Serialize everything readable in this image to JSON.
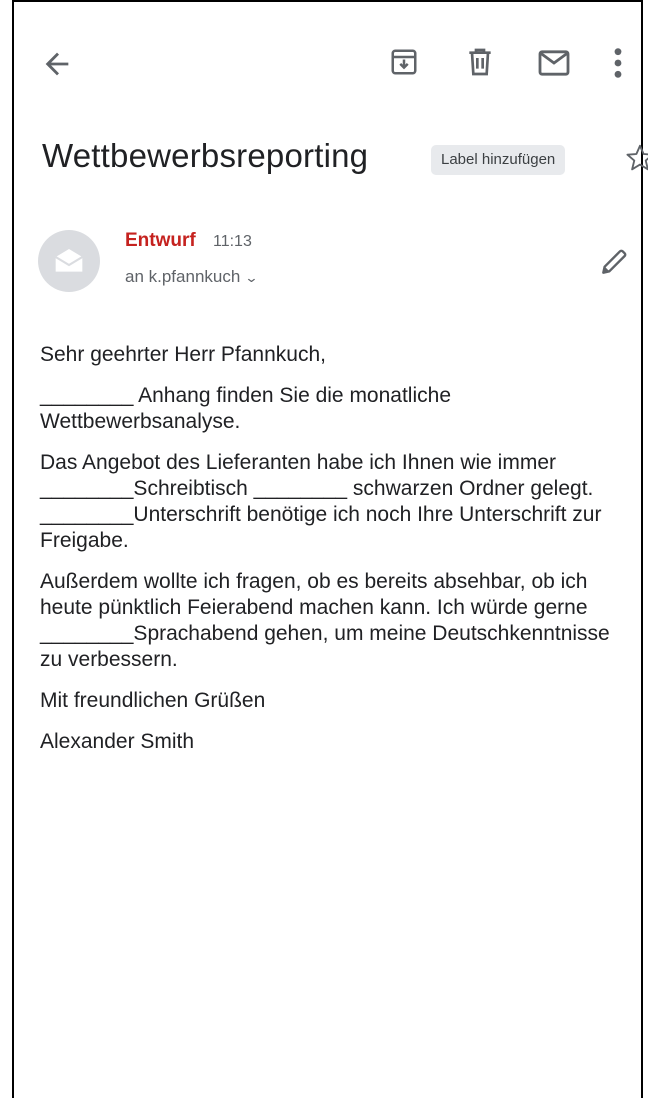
{
  "toolbar": {
    "back_icon": "arrow-back-icon",
    "archive_icon": "archive-icon",
    "delete_icon": "trash-icon",
    "mark_unread_icon": "mail-icon",
    "more_icon": "more-vert-icon"
  },
  "email": {
    "subject": "Wettbewerbsreporting",
    "label_chip": "Label hinzufügen",
    "star_icon": "star-outline-icon"
  },
  "message": {
    "avatar_icon": "draft-avatar-icon",
    "sender": "Entwurf",
    "time": "11:13",
    "recipient": "an k.pfannkuch",
    "recipient_chevron": "⌄",
    "edit_icon": "pencil-icon",
    "accent_color": "#c5221f"
  },
  "body": {
    "greeting": "Sehr geehrter Herr Pfannkuch,",
    "p1": "________ Anhang finden Sie die monatliche Wettbewerbsanalyse.",
    "p2": "Das Angebot des Lieferanten habe ich Ihnen wie immer ________Schreibtisch ________ schwarzen Ordner gelegt. ________Unterschrift benötige ich noch Ihre Unterschrift zur Freigabe.",
    "p3": "Außerdem wollte ich fragen, ob es bereits absehbar, ob ich heute pünktlich Feierabend machen kann. Ich würde gerne ________Sprachabend gehen, um meine Deutschkenntnisse zu verbessern.",
    "closing": "Mit freundlichen Grüßen",
    "signature": "Alexander Smith"
  }
}
